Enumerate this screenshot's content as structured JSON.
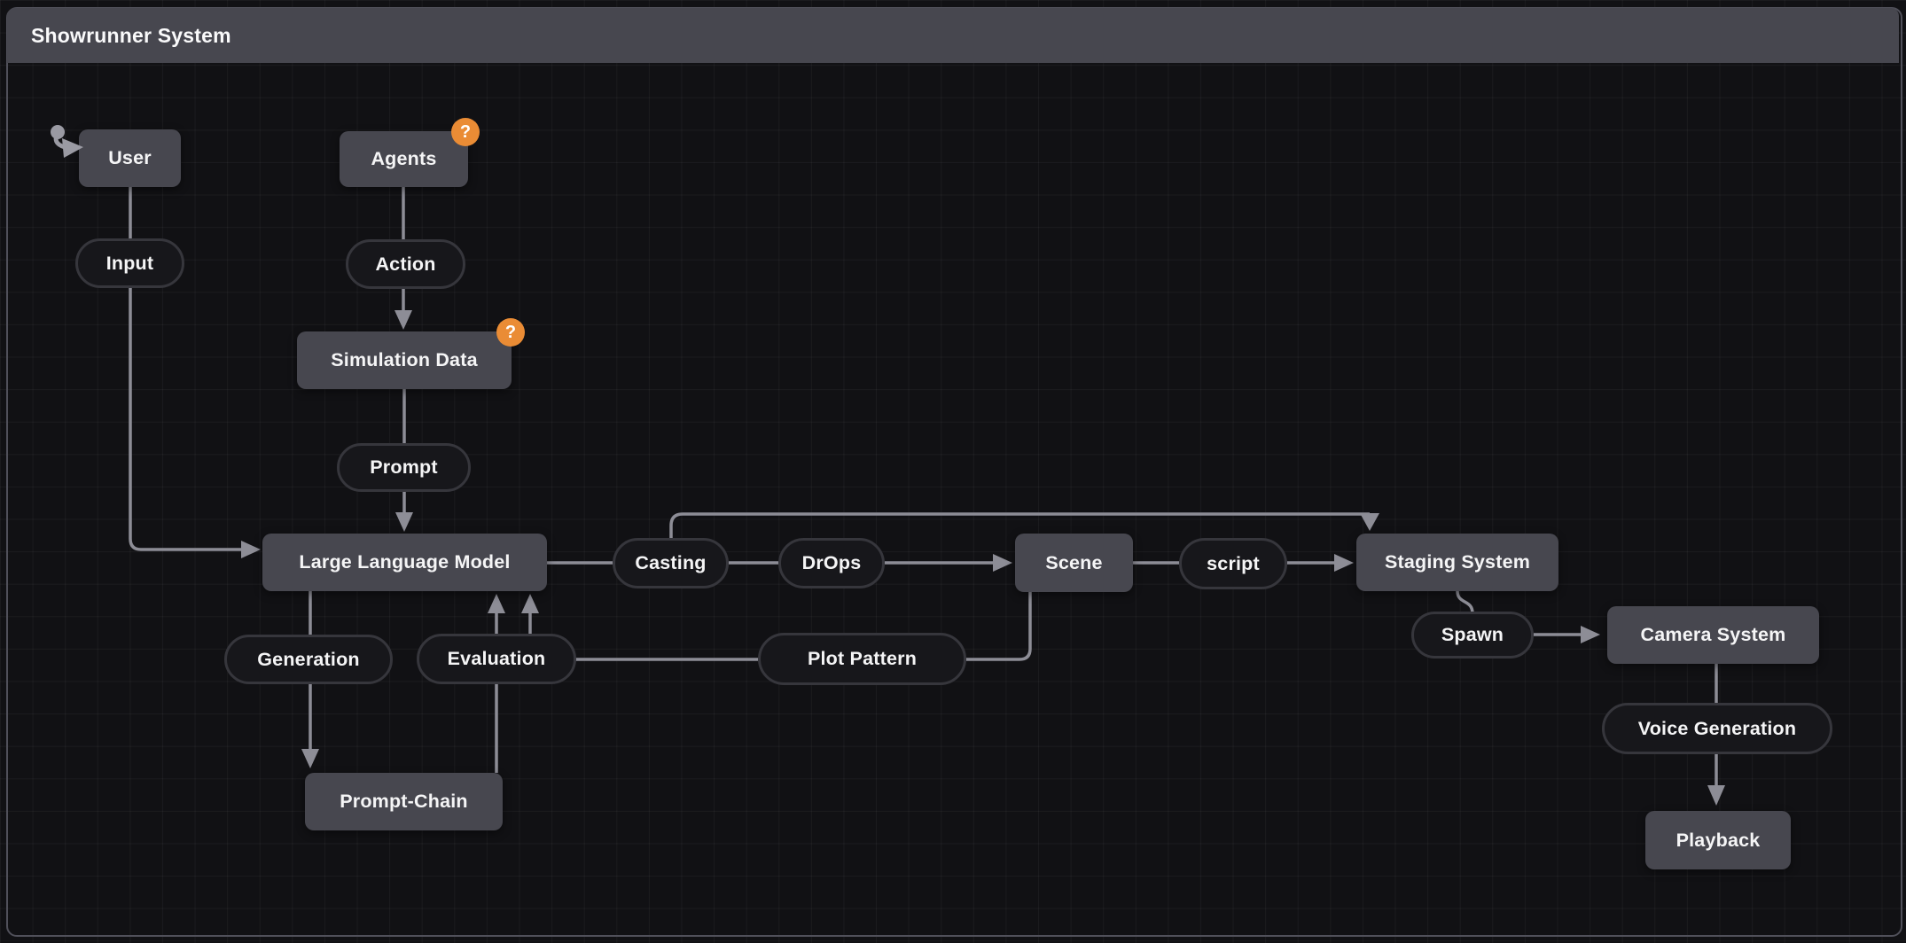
{
  "title": "Showrunner System",
  "nodes": {
    "user": {
      "label": "User"
    },
    "agents": {
      "label": "Agents"
    },
    "simulation_data": {
      "label": "Simulation Data"
    },
    "llm": {
      "label": "Large Language Model"
    },
    "scene": {
      "label": "Scene"
    },
    "staging": {
      "label": "Staging System"
    },
    "prompt_chain": {
      "label": "Prompt-Chain"
    },
    "camera": {
      "label": "Camera System"
    },
    "playback": {
      "label": "Playback"
    }
  },
  "edge_labels": {
    "input": "Input",
    "action": "Action",
    "prompt": "Prompt",
    "casting": "Casting",
    "drops": "DrOps",
    "script": "script",
    "generation": "Generation",
    "evaluation": "Evaluation",
    "plot_pattern": "Plot Pattern",
    "spawn": "Spawn",
    "voice_generation": "Voice Generation"
  },
  "badges": {
    "agents": "?",
    "simulation_data": "?"
  },
  "edges": [
    {
      "from": "User",
      "via": "Input",
      "to": "Large Language Model"
    },
    {
      "from": "Agents",
      "via": "Action",
      "to": "Simulation Data"
    },
    {
      "from": "Simulation Data",
      "via": "Prompt",
      "to": "Large Language Model"
    },
    {
      "from": "Large Language Model",
      "via": "Casting",
      "to": "Staging System"
    },
    {
      "from": "Large Language Model",
      "via": "DrOps",
      "to": "Scene"
    },
    {
      "from": "Large Language Model",
      "via": "Generation",
      "to": "Prompt-Chain"
    },
    {
      "from": "Prompt-Chain",
      "via": "Evaluation",
      "to": "Large Language Model"
    },
    {
      "from": "Scene",
      "via": "Plot Pattern",
      "to": "Large Language Model"
    },
    {
      "from": "Scene",
      "via": "script",
      "to": "Staging System"
    },
    {
      "from": "Staging System",
      "via": "Spawn",
      "to": "Camera System"
    },
    {
      "from": "Camera System",
      "via": "Voice Generation",
      "to": "Playback"
    }
  ],
  "icons": {
    "pointer": "pointer-click-icon"
  },
  "colors": {
    "page_background": "#111114",
    "grid_line": "#26262b",
    "titlebar": "#47474f",
    "container_border": "#50505a",
    "node_fill": "#47474f",
    "node_text": "#f5f5f6",
    "pill_fill": "#17171b",
    "pill_border": "#36363c",
    "edge": "#8d8d96",
    "badge": "#ea8c35",
    "badge_text": "#ffffff"
  }
}
